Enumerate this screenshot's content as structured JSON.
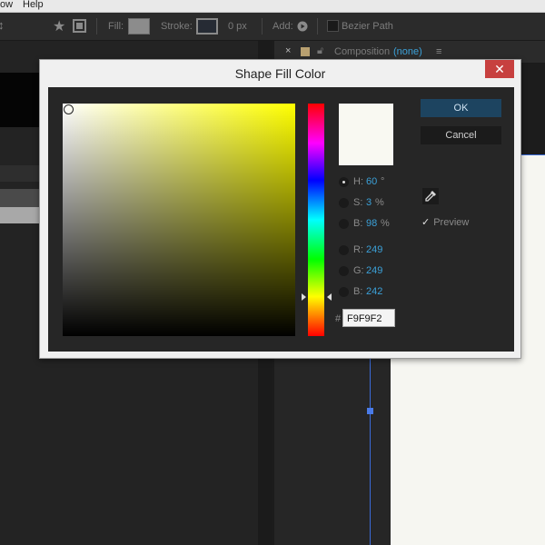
{
  "menu": {
    "item_left": "ow",
    "help": "Help"
  },
  "toolbar": {
    "fill_label": "Fill:",
    "stroke_label": "Stroke:",
    "stroke_width": "0 px",
    "add_label": "Add:",
    "bezier_label": "Bezier Path"
  },
  "composition": {
    "label": "Composition",
    "value": "(none)"
  },
  "dialog": {
    "title": "Shape Fill Color",
    "ok": "OK",
    "cancel": "Cancel",
    "preview": "Preview",
    "hex_hash": "#",
    "hex": "F9F9F2",
    "hsb": [
      {
        "label": "H:",
        "value": "60",
        "unit": "°"
      },
      {
        "label": "S:",
        "value": "3",
        "unit": "%"
      },
      {
        "label": "B:",
        "value": "98",
        "unit": "%"
      }
    ],
    "rgb": [
      {
        "label": "R:",
        "value": "249"
      },
      {
        "label": "G:",
        "value": "249"
      },
      {
        "label": "B:",
        "value": "242"
      }
    ],
    "selected_color": "#f9f9f2",
    "ok_color": "#1d4460",
    "close_color": "#c7403f"
  },
  "icons": [
    "star-icon",
    "shape-tool-icon",
    "play-circle-icon",
    "close-icon",
    "lock-icon",
    "menu-icon",
    "eyedropper-icon",
    "checkmark-icon"
  ]
}
